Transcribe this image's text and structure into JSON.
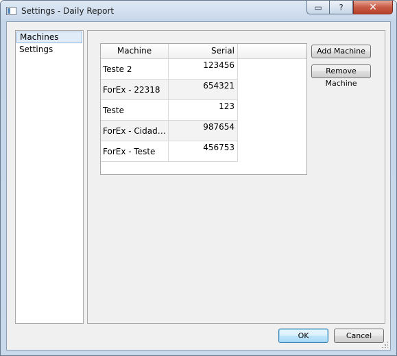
{
  "window": {
    "title": "Settings - Daily Report",
    "help_glyph": "?",
    "close_glyph": "✕",
    "restore_glyph": "▭"
  },
  "nav": {
    "items": [
      {
        "label": "Machines",
        "selected": true
      },
      {
        "label": "Settings",
        "selected": false
      }
    ]
  },
  "table": {
    "columns": [
      "Machine",
      "Serial"
    ],
    "rows": [
      {
        "machine": "Teste 2",
        "serial": "123456"
      },
      {
        "machine": "ForEx - 22318",
        "serial": "654321"
      },
      {
        "machine": "Teste",
        "serial": "123"
      },
      {
        "machine": "ForEx - Cidade J...",
        "serial": "987654"
      },
      {
        "machine": "ForEx - Teste",
        "serial": "456753"
      }
    ]
  },
  "actions": {
    "add_label": "Add Machine",
    "remove_label": "Remove Machine"
  },
  "dialog": {
    "ok_label": "OK",
    "cancel_label": "Cancel"
  }
}
